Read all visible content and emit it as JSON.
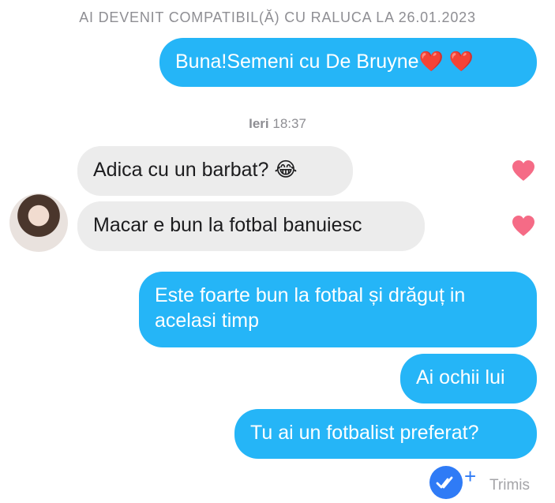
{
  "match_banner": "AI DEVENIT COMPATIBIL(Ă) CU RALUCA LA 26.01.2023",
  "timestamp": {
    "day": "Ieri",
    "time": "18:37"
  },
  "messages": [
    {
      "text": "Buna!Semeni cu De Bruyne",
      "emoji": "❤️ ❤️",
      "direction": "outgoing"
    },
    {
      "text": "Adica cu un barbat?",
      "emoji": "😂",
      "direction": "incoming",
      "liked": true
    },
    {
      "text": "Macar e bun la fotbal banuiesc",
      "direction": "incoming",
      "liked": true
    },
    {
      "text": "Este foarte bun la fotbal și drăguț in acelasi timp",
      "direction": "outgoing"
    },
    {
      "text": "Ai ochii lui",
      "direction": "outgoing"
    },
    {
      "text": "Tu ai un fotbalist preferat?",
      "direction": "outgoing"
    }
  ],
  "status": {
    "sent_label": "Trimis",
    "read_icon": "double-check-icon",
    "plus": "+"
  },
  "colors": {
    "outgoing_bubble": "#25b5f7",
    "incoming_bubble": "#ececec",
    "heart": "#f56b86",
    "accent": "#2f7bf6"
  }
}
